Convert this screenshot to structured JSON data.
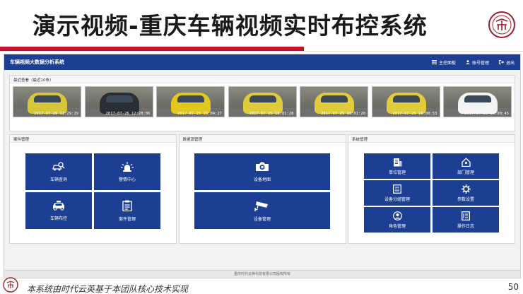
{
  "slide": {
    "title": "演示视频-重庆车辆视频实时布控系统",
    "footnote": "本系统由时代云英基于本团队核心技术实现",
    "page_number": "50"
  },
  "app": {
    "title": "车辆视频大数据分析系统",
    "nav": [
      {
        "label": "主控面板",
        "icon": "list-icon"
      },
      {
        "label": "账号管理",
        "icon": "user-icon"
      },
      {
        "label": "退出",
        "icon": "logout-icon"
      }
    ],
    "footer": "重庆时代云英科技有限公司版权所有"
  },
  "recent": {
    "heading": "最近查看（最近10条）",
    "items": [
      {
        "timestamp": "2017-07-26 12:29:19",
        "car_color": "#d7c53a"
      },
      {
        "timestamp": "2017-07-26 12:28:06",
        "car_color": "#2a2e35"
      },
      {
        "timestamp": "2017-07-25 16:04:27",
        "car_color": "#e2c81c"
      },
      {
        "timestamp": "2017-07-25 16:01:28",
        "car_color": "#e0cc3a"
      },
      {
        "timestamp": "2017-07-25 16:01:20",
        "car_color": "#e0cc3a"
      },
      {
        "timestamp": "2017-07-25 16:00:53",
        "car_color": "#e0cc3a"
      },
      {
        "timestamp": "2017-07-25 16:00:45",
        "car_color": "#f4f4f4"
      }
    ]
  },
  "modules": [
    {
      "heading": "案件管理",
      "tiles": [
        {
          "label": "车辆查询",
          "icon": "car-search-icon"
        },
        {
          "label": "警情中心",
          "icon": "alarm-light-icon"
        },
        {
          "label": "车辆布控",
          "icon": "taxi-icon"
        },
        {
          "label": "案件管理",
          "icon": "clipboard-icon"
        }
      ]
    },
    {
      "heading": "数据源管理",
      "tiles": [
        {
          "label": "设备地图",
          "icon": "camera-icon"
        },
        {
          "label": "设备管理",
          "icon": "cctv-icon"
        }
      ]
    },
    {
      "heading": "系统管理",
      "tiles": [
        {
          "label": "单位管理",
          "icon": "building-icon"
        },
        {
          "label": "部门管理",
          "icon": "house-icon"
        },
        {
          "label": "设备分组管理",
          "icon": "list-doc-icon"
        },
        {
          "label": "参数设置",
          "icon": "gear-icon"
        },
        {
          "label": "角色管理",
          "icon": "person-icon"
        },
        {
          "label": "操作日志",
          "icon": "log-icon"
        }
      ]
    }
  ],
  "colors": {
    "brand_blue": "#1c3f94",
    "accent_red": "#c8102e"
  }
}
